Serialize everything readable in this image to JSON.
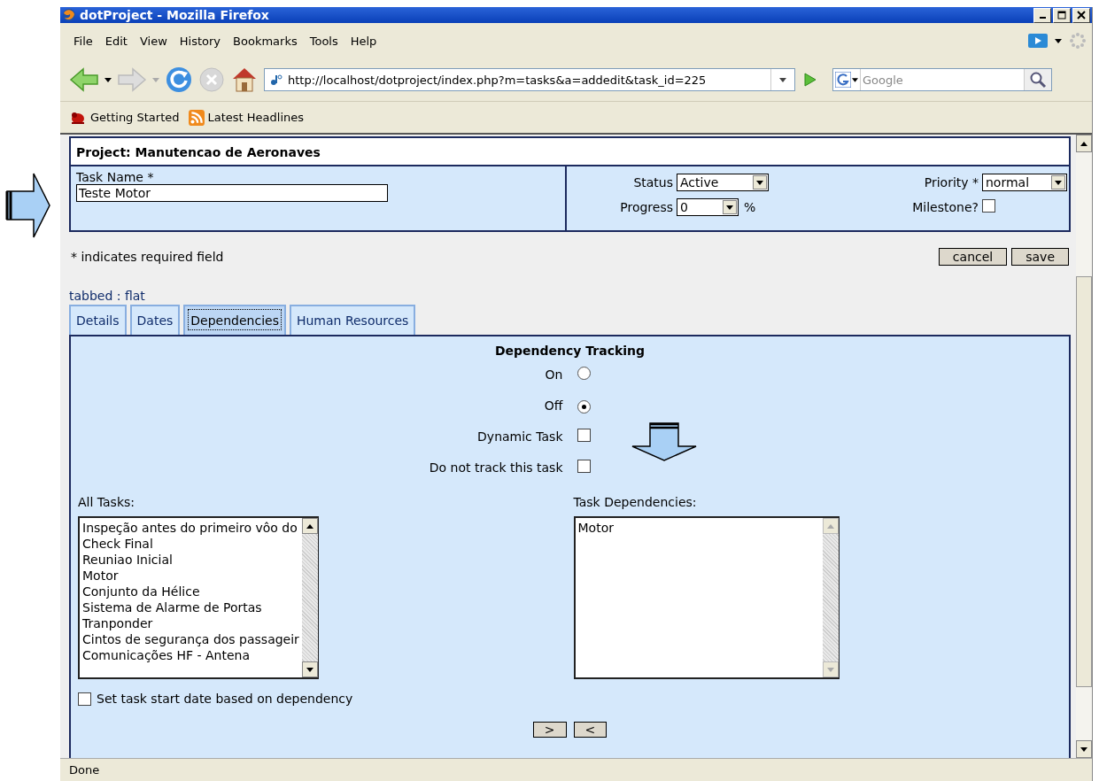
{
  "window": {
    "title": "dotProject - Mozilla Firefox"
  },
  "menu": [
    "File",
    "Edit",
    "View",
    "History",
    "Bookmarks",
    "Tools",
    "Help"
  ],
  "address_bar": {
    "url": "http://localhost/dotproject/index.php?m=tasks&a=addedit&task_id=225"
  },
  "search": {
    "placeholder": "Google"
  },
  "bookmarks": [
    {
      "label": "Getting Started",
      "kind": "page"
    },
    {
      "label": "Latest Headlines",
      "kind": "feed"
    }
  ],
  "project": {
    "title": "Project: Manutencao de Aeronaves"
  },
  "task_name": {
    "label": "Task Name *",
    "value": "Teste Motor"
  },
  "status": {
    "label": "Status",
    "value": "Active"
  },
  "progress": {
    "label": "Progress",
    "value": "0",
    "unit": "%"
  },
  "priority": {
    "label": "Priority *",
    "value": "normal"
  },
  "milestone": {
    "label": "Milestone?",
    "checked": false
  },
  "required_note": "* indicates required field",
  "actions": [
    "cancel",
    "save"
  ],
  "view_mode": "tabbed : flat",
  "tabs": [
    {
      "label": "Details",
      "selected": false
    },
    {
      "label": "Dates",
      "selected": false
    },
    {
      "label": "Dependencies",
      "selected": true
    },
    {
      "label": "Human Resources",
      "selected": false
    }
  ],
  "dependency_tracking": {
    "title": "Dependency Tracking",
    "options": [
      {
        "label": "On",
        "selected": false
      },
      {
        "label": "Off",
        "selected": true
      }
    ],
    "checkboxes": [
      {
        "label": "Dynamic Task",
        "checked": false
      },
      {
        "label": "Do not track this task",
        "checked": false
      }
    ]
  },
  "all_tasks": {
    "label": "All Tasks:",
    "items": [
      "Inspeção antes do primeiro vôo do",
      "Check Final",
      "Reuniao Inicial",
      "Motor",
      "Conjunto da Hélice",
      "Sistema de Alarme de Portas",
      "Tranponder",
      "Cintos de segurança dos passageir",
      "Comunicações HF - Antena"
    ]
  },
  "task_dependencies": {
    "label": "Task Dependencies:",
    "items": [
      "Motor"
    ]
  },
  "set_start_date": {
    "label": "Set task start date based on dependency",
    "checked": false
  },
  "move_buttons": [
    ">",
    "<"
  ],
  "status_bar": {
    "text": "Done"
  }
}
